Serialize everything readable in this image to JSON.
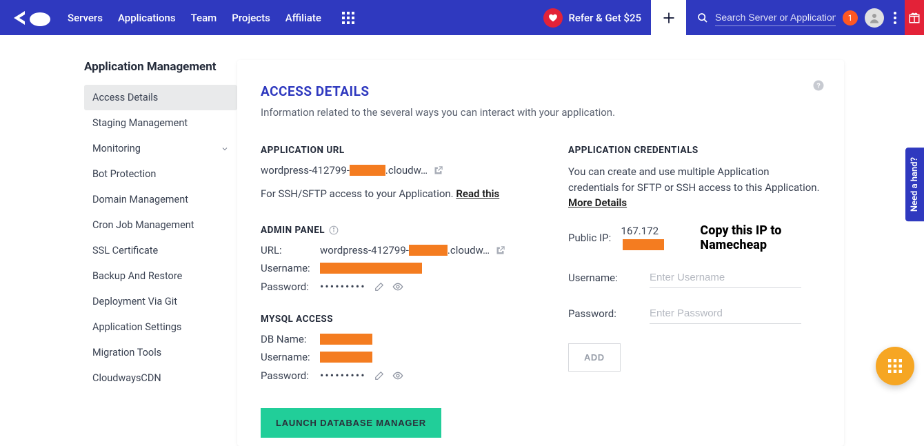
{
  "nav": {
    "links": [
      "Servers",
      "Applications",
      "Team",
      "Projects",
      "Affiliate"
    ],
    "refer": "Refer & Get $25",
    "search_placeholder": "Search Server or Application",
    "notif_count": "1"
  },
  "sidebar": {
    "title": "Application Management",
    "items": [
      {
        "label": "Access Details"
      },
      {
        "label": "Staging Management"
      },
      {
        "label": "Monitoring"
      },
      {
        "label": "Bot Protection"
      },
      {
        "label": "Domain Management"
      },
      {
        "label": "Cron Job Management"
      },
      {
        "label": "SSL Certificate"
      },
      {
        "label": "Backup And Restore"
      },
      {
        "label": "Deployment Via Git"
      },
      {
        "label": "Application Settings"
      },
      {
        "label": "Migration Tools"
      },
      {
        "label": "CloudwaysCDN"
      }
    ]
  },
  "page": {
    "title": "ACCESS DETAILS",
    "subtitle": "Information related to the several ways you can interact with your application."
  },
  "app_url": {
    "heading": "APPLICATION URL",
    "prefix": "wordpress-412799-",
    "suffix": ".cloudw…",
    "ssh_note_pre": "For SSH/SFTP access to your Application. ",
    "ssh_note_link": "Read this"
  },
  "admin": {
    "heading": "ADMIN PANEL",
    "url_label": "URL:",
    "url_prefix": "wordpress-412799-",
    "url_suffix": ".cloudw…",
    "username_label": "Username:",
    "password_label": "Password:",
    "password_mask": "•••••••••"
  },
  "mysql": {
    "heading": "MYSQL ACCESS",
    "db_label": "DB Name:",
    "username_label": "Username:",
    "password_label": "Password:",
    "password_mask": "•••••••••",
    "launch": "LAUNCH DATABASE MANAGER"
  },
  "credentials": {
    "heading": "APPLICATION CREDENTIALS",
    "desc_pre": "You can create and use multiple Application credentials for SFTP or SSH access to this Application. ",
    "desc_link": "More Details",
    "public_ip_label": "Public IP:",
    "public_ip_prefix": "167.172",
    "copy_annotation": "Copy this IP to Namecheap",
    "username_label": "Username:",
    "username_placeholder": "Enter Username",
    "password_label": "Password:",
    "password_placeholder": "Enter Password",
    "add": "ADD"
  },
  "float": {
    "need_hand": "Need a hand?"
  }
}
